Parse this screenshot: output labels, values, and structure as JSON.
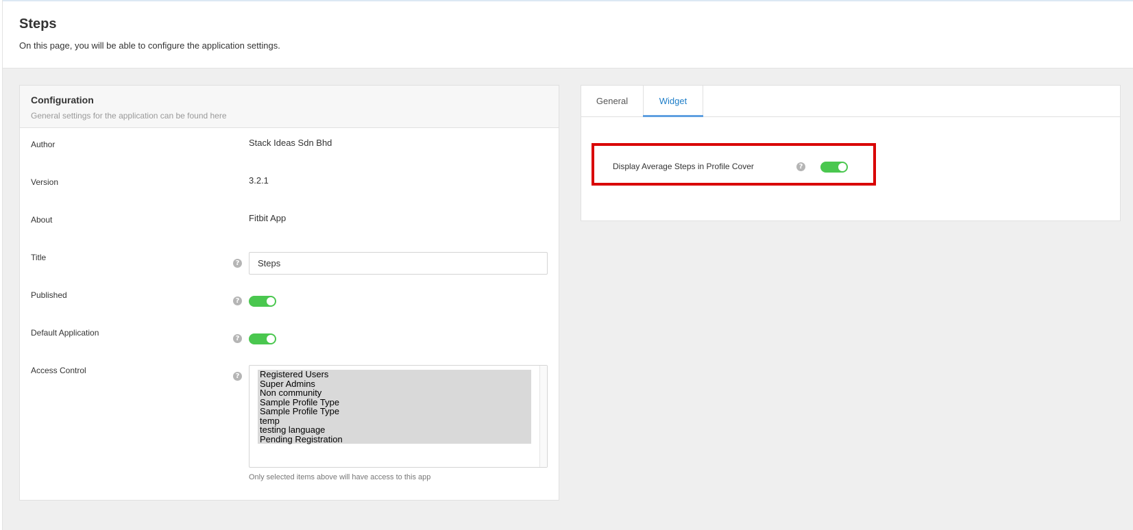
{
  "page": {
    "title": "Steps",
    "description": "On this page, you will be able to configure the application settings."
  },
  "config": {
    "title": "Configuration",
    "subtitle": "General settings for the application can be found here",
    "author": {
      "label": "Author",
      "value": "Stack Ideas Sdn Bhd"
    },
    "version": {
      "label": "Version",
      "value": "3.2.1"
    },
    "about": {
      "label": "About",
      "value": "Fitbit App"
    },
    "title_field": {
      "label": "Title",
      "value": "Steps"
    },
    "published": {
      "label": "Published",
      "enabled": true
    },
    "default_application": {
      "label": "Default Application",
      "enabled": true
    },
    "access_control": {
      "label": "Access Control",
      "options": [
        "Registered Users",
        "Super Admins",
        "Non community",
        "Sample Profile Type",
        "Sample Profile Type",
        "temp",
        "testing language",
        "Pending Registration"
      ],
      "help_text": "Only selected items above will have access to this app"
    }
  },
  "widget_panel": {
    "tabs": [
      {
        "label": "General",
        "active": false
      },
      {
        "label": "Widget",
        "active": true
      }
    ],
    "display_average_steps": {
      "label": "Display Average Steps in Profile Cover",
      "enabled": true
    }
  },
  "colors": {
    "toggle_on": "#4ac74f",
    "active_tab": "#1e7ec8",
    "highlight": "#d90000"
  },
  "icons": {
    "help": "question-circle-icon"
  }
}
